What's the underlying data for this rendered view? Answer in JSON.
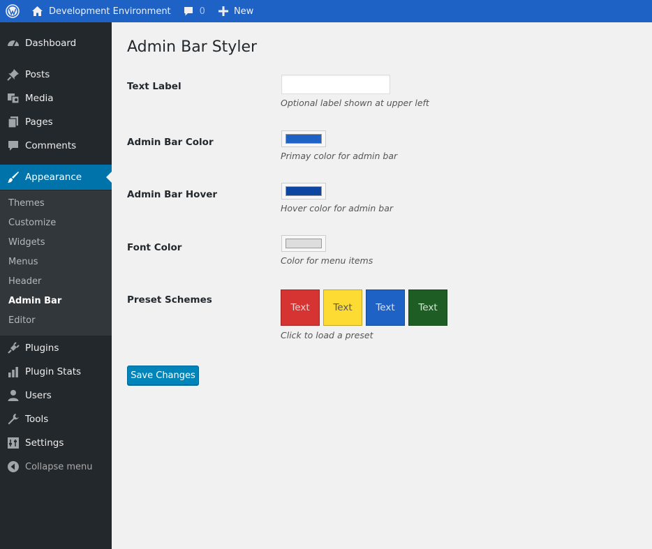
{
  "admin_bar": {
    "site_name": "Development Environment",
    "comments_count": "0",
    "new_label": "New",
    "colors": {
      "background": "#1e62c6",
      "text": "#f0f0f0"
    }
  },
  "sidebar": {
    "items": [
      {
        "label": "Dashboard",
        "icon": "dashboard-icon"
      },
      {
        "label": "Posts",
        "icon": "pin-icon"
      },
      {
        "label": "Media",
        "icon": "media-icon"
      },
      {
        "label": "Pages",
        "icon": "pages-icon"
      },
      {
        "label": "Comments",
        "icon": "comment-icon"
      },
      {
        "label": "Appearance",
        "icon": "paintbrush-icon",
        "current": true
      },
      {
        "label": "Plugins",
        "icon": "plug-icon"
      },
      {
        "label": "Plugin Stats",
        "icon": "bar-chart-icon"
      },
      {
        "label": "Users",
        "icon": "user-icon"
      },
      {
        "label": "Tools",
        "icon": "wrench-icon"
      },
      {
        "label": "Settings",
        "icon": "settings-icon"
      },
      {
        "label": "Collapse menu",
        "icon": "collapse-icon"
      }
    ],
    "submenu": [
      "Themes",
      "Customize",
      "Widgets",
      "Menus",
      "Header",
      "Admin Bar",
      "Editor"
    ],
    "active_submenu": "Admin Bar",
    "colors": {
      "background": "#23282d",
      "submenu_background": "#32373c",
      "current": "#0073aa"
    }
  },
  "page": {
    "title": "Admin Bar Styler",
    "fields": {
      "text_label": {
        "label": "Text Label",
        "value": "",
        "placeholder": "",
        "description": "Optional label shown at upper left"
      },
      "bar_color": {
        "label": "Admin Bar Color",
        "value": "#1e62c6",
        "description": "Primay color for admin bar"
      },
      "hover_color": {
        "label": "Admin Bar Hover",
        "value": "#0d46a0",
        "description": "Hover color for admin bar"
      },
      "font_color": {
        "label": "Font Color",
        "value": "#dddddd",
        "description": "Color for menu items"
      }
    },
    "presets": {
      "label": "Preset Schemes",
      "description": "Click to load a preset",
      "items": [
        {
          "label": "Text",
          "bg": "#d63333",
          "fg": "#f4d0d0"
        },
        {
          "label": "Text",
          "bg": "#fddb33",
          "fg": "#555555"
        },
        {
          "label": "Text",
          "bg": "#1e62c6",
          "fg": "#d7e3f6"
        },
        {
          "label": "Text",
          "bg": "#1e5e24",
          "fg": "#d6e6d6"
        }
      ]
    },
    "save_label": "Save Changes"
  }
}
